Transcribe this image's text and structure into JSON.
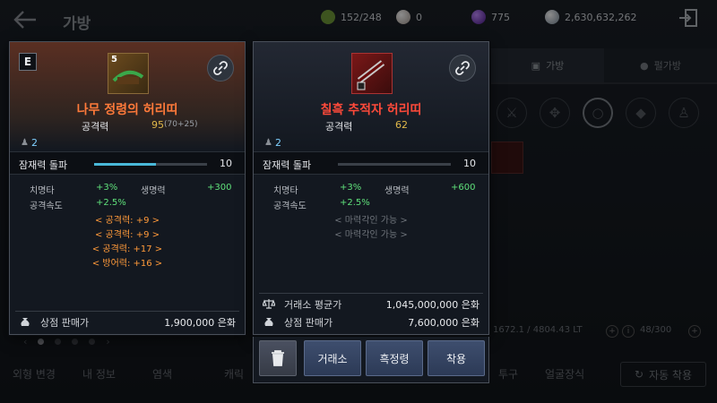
{
  "header": {
    "title": "가방",
    "currencies": [
      {
        "icon": "weight-bag-icon",
        "value": "152/248",
        "color": "#8fb84a"
      },
      {
        "icon": "pearl-icon",
        "value": "0",
        "color": "#c8c0b8"
      },
      {
        "icon": "purple-gem-icon",
        "value": "775",
        "color": "#7a3ad8"
      },
      {
        "icon": "silver-coin-icon",
        "value": "2,630,632,262",
        "color": "#b8c4d0"
      }
    ]
  },
  "right_tabs": [
    {
      "label": "가방"
    },
    {
      "label": "펄가방"
    }
  ],
  "inventory": {
    "weight": "1672.1 / 4804.43 LT",
    "slots": "48/300"
  },
  "bottom": {
    "left_labels": [
      "외형 변경",
      "내 정보",
      "염색"
    ],
    "mid_labels": [
      "캐릭",
      "투구",
      "얼굴장식"
    ],
    "auto_equip": "자동 착용"
  },
  "left_item": {
    "grade": "E",
    "enhance": "5",
    "name": "나무 정령의 허리띠",
    "main_stat_label": "공격력",
    "main_stat_value": "95",
    "main_stat_sub": "(70+25)",
    "level": "2",
    "break_label": "잠재력 돌파",
    "break_value": "10",
    "break_fill": 0.55,
    "options": [
      {
        "label": "치명타",
        "value": "+3%"
      },
      {
        "label": "생명력",
        "value": "+300"
      },
      {
        "label": "공격속도",
        "value": "+2.5%"
      }
    ],
    "inherit": [
      "< 공격력: +9 >",
      "< 공격력: +9 >",
      "< 공격력: +17 >",
      "< 방어력: +16 >"
    ],
    "sell_label": "상점 판매가",
    "sell_value": "1,900,000 은화"
  },
  "right_item": {
    "name": "칠흑 추적자 허리띠",
    "main_stat_label": "공격력",
    "main_stat_value": "62",
    "level": "2",
    "break_label": "잠재력 돌파",
    "break_value": "10",
    "break_fill": 0.0,
    "options": [
      {
        "label": "치명타",
        "value": "+3%"
      },
      {
        "label": "생명력",
        "value": "+600"
      },
      {
        "label": "공격속도",
        "value": "+2.5%"
      }
    ],
    "inherit": [
      "< 마력각인 가능 >",
      "< 마력각인 가능 >"
    ],
    "market_label": "거래소 평균가",
    "market_value": "1,045,000,000 은화",
    "sell_label": "상점 판매가",
    "sell_value": "7,600,000 은화"
  },
  "actions": [
    {
      "label": "거래소"
    },
    {
      "label": "흑정령"
    },
    {
      "label": "착용"
    }
  ]
}
